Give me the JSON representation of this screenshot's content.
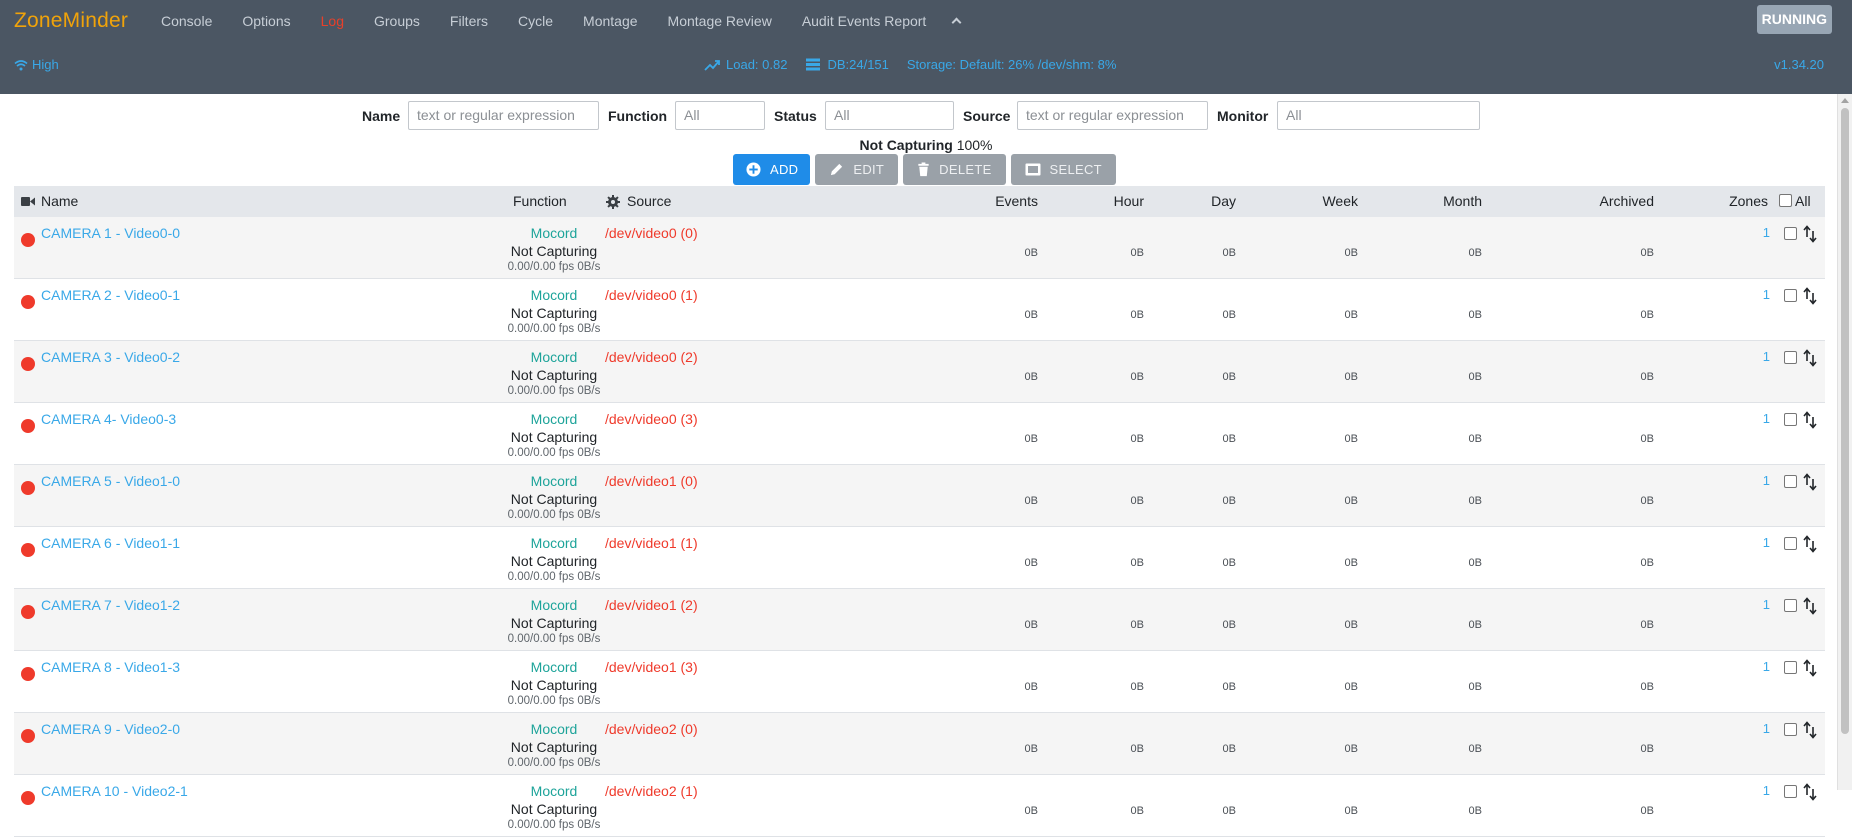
{
  "brand": "ZoneMinder",
  "nav": [
    {
      "label": "Console",
      "active": false
    },
    {
      "label": "Options",
      "active": false
    },
    {
      "label": "Log",
      "active": true
    },
    {
      "label": "Groups",
      "active": false
    },
    {
      "label": "Filters",
      "active": false
    },
    {
      "label": "Cycle",
      "active": false
    },
    {
      "label": "Montage",
      "active": false
    },
    {
      "label": "Montage Review",
      "active": false
    },
    {
      "label": "Audit Events Report",
      "active": false
    }
  ],
  "running_label": "RUNNING",
  "status_bar": {
    "bandwidth": "High",
    "load": "Load: 0.82",
    "db": "DB:24/151",
    "storage": "Storage: Default: 26% /dev/shm: 8%",
    "version": "v1.34.20"
  },
  "filters": {
    "name_label": "Name",
    "name_placeholder": "text or regular expression",
    "function_label": "Function",
    "function_value": "All",
    "status_label": "Status",
    "status_value": "All",
    "source_label": "Source",
    "source_placeholder": "text or regular expression",
    "monitor_label": "Monitor",
    "monitor_value": "All"
  },
  "summary": {
    "state": "Not Capturing",
    "percent": "100%"
  },
  "toolbar": {
    "add": "ADD",
    "edit": "EDIT",
    "delete": "DELETE",
    "select": "SELECT"
  },
  "table": {
    "headers": {
      "name": "Name",
      "function": "Function",
      "source": "Source",
      "events": "Events",
      "hour": "Hour",
      "day": "Day",
      "week": "Week",
      "month": "Month",
      "archived": "Archived",
      "zones": "Zones",
      "all": "All"
    },
    "rows": [
      {
        "name": "CAMERA 1 - Video0-0",
        "function": "Mocord",
        "state": "Not Capturing",
        "fps": "0.00/0.00 fps 0B/s",
        "source": "/dev/video0 (0)",
        "events": "0B",
        "hour": "0B",
        "day": "0B",
        "week": "0B",
        "month": "0B",
        "archived": "0B",
        "zones": "1"
      },
      {
        "name": "CAMERA 2 - Video0-1",
        "function": "Mocord",
        "state": "Not Capturing",
        "fps": "0.00/0.00 fps 0B/s",
        "source": "/dev/video0 (1)",
        "events": "0B",
        "hour": "0B",
        "day": "0B",
        "week": "0B",
        "month": "0B",
        "archived": "0B",
        "zones": "1"
      },
      {
        "name": "CAMERA 3 - Video0-2",
        "function": "Mocord",
        "state": "Not Capturing",
        "fps": "0.00/0.00 fps 0B/s",
        "source": "/dev/video0 (2)",
        "events": "0B",
        "hour": "0B",
        "day": "0B",
        "week": "0B",
        "month": "0B",
        "archived": "0B",
        "zones": "1"
      },
      {
        "name": "CAMERA 4- Video0-3",
        "function": "Mocord",
        "state": "Not Capturing",
        "fps": "0.00/0.00 fps 0B/s",
        "source": "/dev/video0 (3)",
        "events": "0B",
        "hour": "0B",
        "day": "0B",
        "week": "0B",
        "month": "0B",
        "archived": "0B",
        "zones": "1"
      },
      {
        "name": "CAMERA 5 - Video1-0",
        "function": "Mocord",
        "state": "Not Capturing",
        "fps": "0.00/0.00 fps 0B/s",
        "source": "/dev/video1 (0)",
        "events": "0B",
        "hour": "0B",
        "day": "0B",
        "week": "0B",
        "month": "0B",
        "archived": "0B",
        "zones": "1"
      },
      {
        "name": "CAMERA 6 - Video1-1",
        "function": "Mocord",
        "state": "Not Capturing",
        "fps": "0.00/0.00 fps 0B/s",
        "source": "/dev/video1 (1)",
        "events": "0B",
        "hour": "0B",
        "day": "0B",
        "week": "0B",
        "month": "0B",
        "archived": "0B",
        "zones": "1"
      },
      {
        "name": "CAMERA 7 - Video1-2",
        "function": "Mocord",
        "state": "Not Capturing",
        "fps": "0.00/0.00 fps 0B/s",
        "source": "/dev/video1 (2)",
        "events": "0B",
        "hour": "0B",
        "day": "0B",
        "week": "0B",
        "month": "0B",
        "archived": "0B",
        "zones": "1"
      },
      {
        "name": "CAMERA 8 - Video1-3",
        "function": "Mocord",
        "state": "Not Capturing",
        "fps": "0.00/0.00 fps 0B/s",
        "source": "/dev/video1 (3)",
        "events": "0B",
        "hour": "0B",
        "day": "0B",
        "week": "0B",
        "month": "0B",
        "archived": "0B",
        "zones": "1"
      },
      {
        "name": "CAMERA 9 - Video2-0",
        "function": "Mocord",
        "state": "Not Capturing",
        "fps": "0.00/0.00 fps 0B/s",
        "source": "/dev/video2 (0)",
        "events": "0B",
        "hour": "0B",
        "day": "0B",
        "week": "0B",
        "month": "0B",
        "archived": "0B",
        "zones": "1"
      },
      {
        "name": "CAMERA 10 - Video2-1",
        "function": "Mocord",
        "state": "Not Capturing",
        "fps": "0.00/0.00 fps 0B/s",
        "source": "/dev/video2 (1)",
        "events": "0B",
        "hour": "0B",
        "day": "0B",
        "week": "0B",
        "month": "0B",
        "archived": "0B",
        "zones": "1"
      }
    ]
  }
}
